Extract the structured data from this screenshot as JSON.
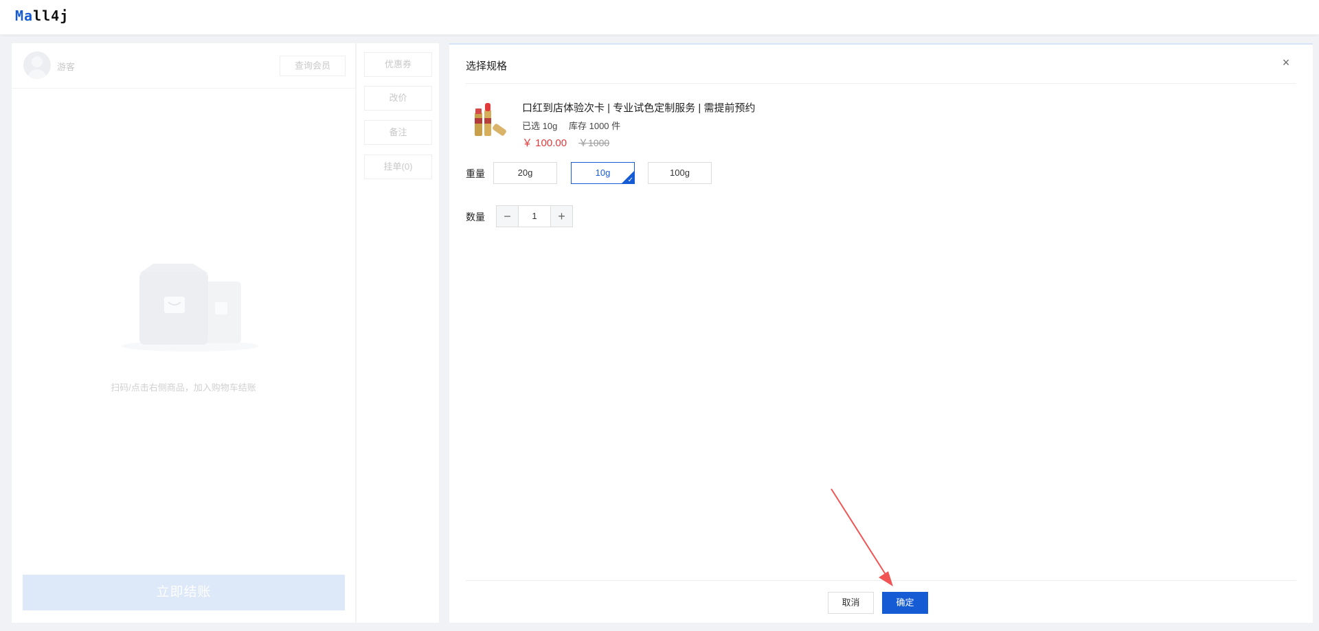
{
  "header": {
    "logo_prefix": "Ma",
    "logo_suffix": "ll4j"
  },
  "member": {
    "name": "游客",
    "query_label": "查询会员"
  },
  "cart": {
    "empty_text": "扫码/点击右侧商品，加入购物车结账",
    "checkout_label": "立即结账"
  },
  "actions": {
    "coupon": "优惠券",
    "change_price": "改价",
    "remark": "备注",
    "hold_order": "挂单(0)"
  },
  "dialog": {
    "title": "选择规格",
    "close_icon": "×",
    "product": {
      "name": "口红到店体验次卡 | 专业试色定制服务 | 需提前预约",
      "selected": "已选 10g",
      "stock": "库存 1000 件",
      "price": "￥ 100.00",
      "original_price": "￥1000"
    },
    "spec": {
      "label": "重量",
      "options": [
        {
          "label": "20g",
          "selected": false
        },
        {
          "label": "10g",
          "selected": true
        },
        {
          "label": "100g",
          "selected": false
        }
      ]
    },
    "quantity": {
      "label": "数量",
      "value": "1",
      "minus": "−",
      "plus": "+"
    },
    "cancel_label": "取消",
    "confirm_label": "确定"
  },
  "colors": {
    "primary": "#155bd4",
    "price": "#e4393c",
    "annotation_arrow": "#f05454"
  }
}
